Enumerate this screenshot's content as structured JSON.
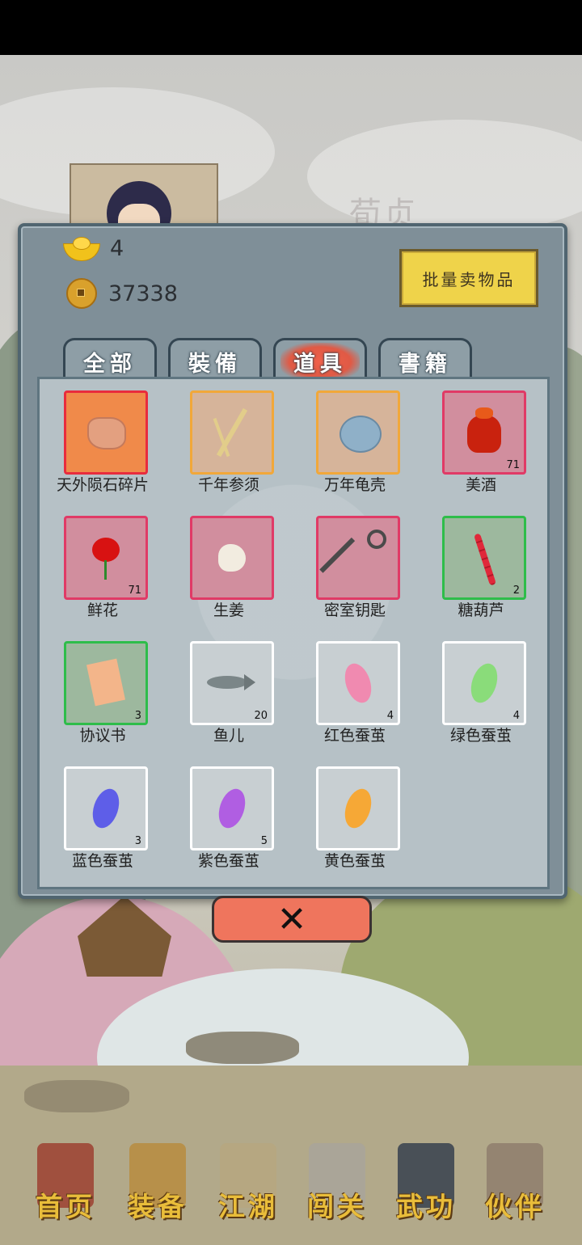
{
  "background": {
    "character_name": "荀贞"
  },
  "currency": {
    "gold_ingot": "4",
    "copper_coins": "37338"
  },
  "batch_sell_label": "批量卖物品",
  "tabs": [
    {
      "label": "全部",
      "active": false
    },
    {
      "label": "裝備",
      "active": false
    },
    {
      "label": "道具",
      "active": true
    },
    {
      "label": "書籍",
      "active": false
    }
  ],
  "items": [
    {
      "name": "天外陨石碎片",
      "qty": "",
      "rarity": "orange",
      "icon": "meteorite-icon"
    },
    {
      "name": "千年参须",
      "qty": "",
      "rarity": "gold",
      "icon": "ginseng-icon"
    },
    {
      "name": "万年龟壳",
      "qty": "",
      "rarity": "gold",
      "icon": "turtle-shell-icon"
    },
    {
      "name": "美酒",
      "qty": "71",
      "rarity": "pink",
      "icon": "wine-jar-icon"
    },
    {
      "name": "鲜花",
      "qty": "71",
      "rarity": "pink",
      "icon": "rose-icon"
    },
    {
      "name": "生姜",
      "qty": "",
      "rarity": "pink",
      "icon": "ginger-icon"
    },
    {
      "name": "密室钥匙",
      "qty": "",
      "rarity": "pink",
      "icon": "key-icon"
    },
    {
      "name": "糖葫芦",
      "qty": "2",
      "rarity": "green",
      "icon": "candied-haws-icon"
    },
    {
      "name": "协议书",
      "qty": "3",
      "rarity": "green",
      "icon": "document-icon"
    },
    {
      "name": "鱼儿",
      "qty": "20",
      "rarity": "white",
      "icon": "fish-icon"
    },
    {
      "name": "红色蚕茧",
      "qty": "4",
      "rarity": "white",
      "icon": "red-cocoon-icon"
    },
    {
      "name": "绿色蚕茧",
      "qty": "4",
      "rarity": "white",
      "icon": "green-cocoon-icon"
    },
    {
      "name": "蓝色蚕茧",
      "qty": "3",
      "rarity": "white",
      "icon": "blue-cocoon-icon"
    },
    {
      "name": "紫色蚕茧",
      "qty": "5",
      "rarity": "white",
      "icon": "purple-cocoon-icon"
    },
    {
      "name": "黄色蚕茧",
      "qty": "",
      "rarity": "white",
      "icon": "yellow-cocoon-icon"
    }
  ],
  "close_label": "✕",
  "nav": [
    {
      "label": "首页",
      "icon": "home-icon"
    },
    {
      "label": "装备",
      "icon": "armor-icon"
    },
    {
      "label": "江湖",
      "icon": "scroll-map-icon"
    },
    {
      "label": "闯关",
      "icon": "crossed-swords-icon"
    },
    {
      "label": "武功",
      "icon": "martial-book-icon"
    },
    {
      "label": "伙伴",
      "icon": "partners-icon"
    }
  ],
  "colors": {
    "rarity_orange": "#e82c3d",
    "rarity_gold": "#f1a83a",
    "rarity_pink": "#e03a66",
    "rarity_green": "#2ebd4a",
    "rarity_white": "#ffffff",
    "nav_text": "#e9bd3a",
    "close_button": "#ef755d"
  }
}
